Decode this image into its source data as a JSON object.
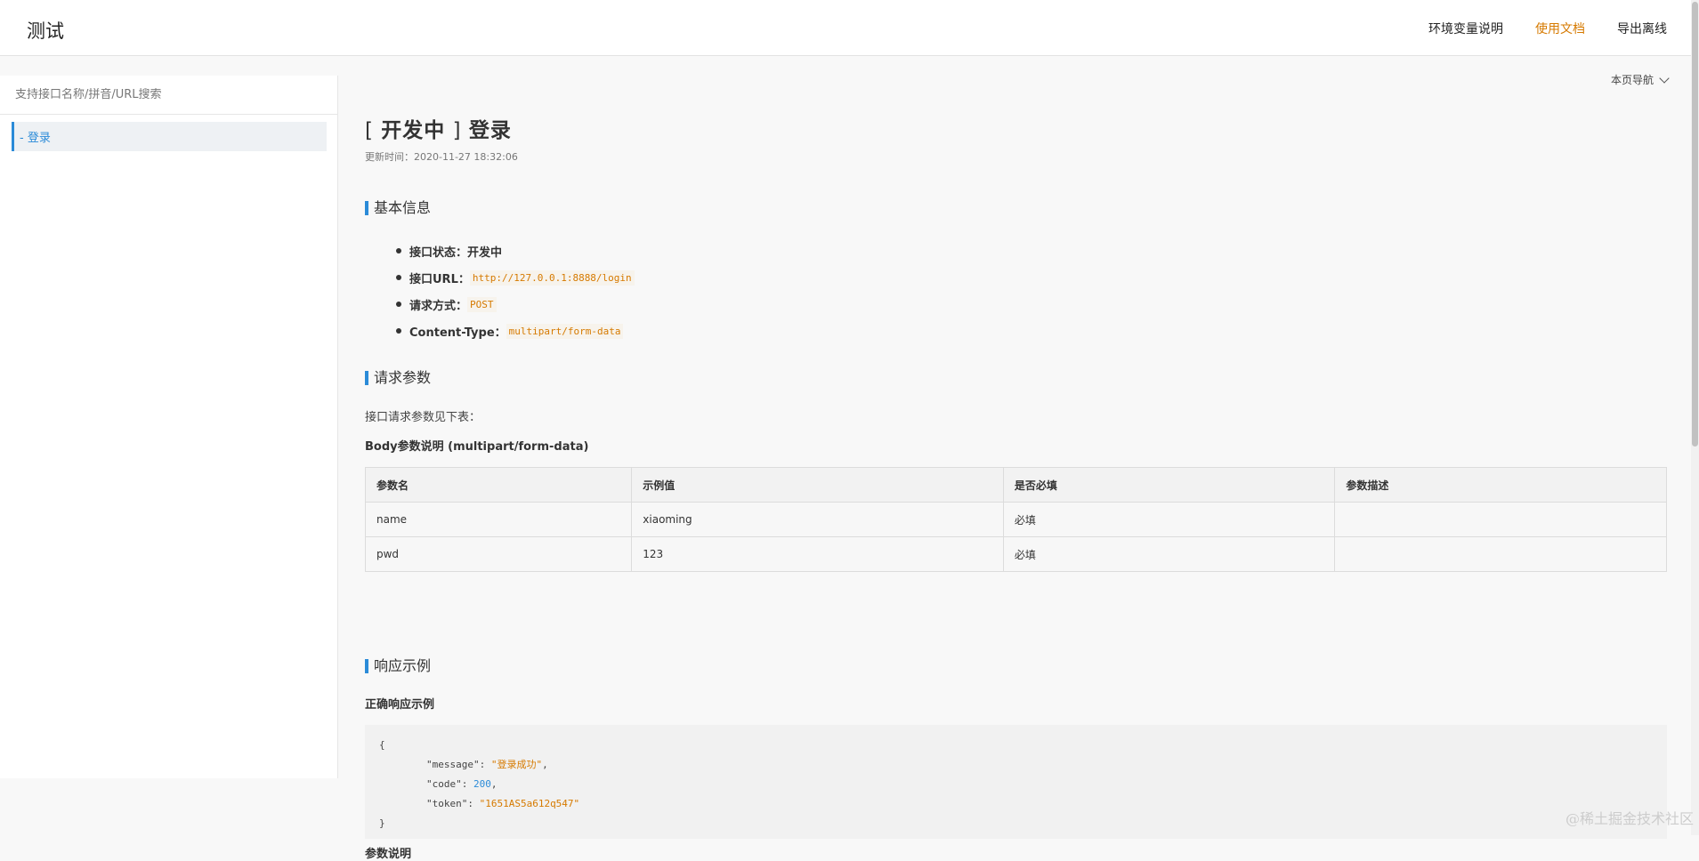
{
  "app": {
    "title": "测试"
  },
  "topnav": [
    {
      "label": "环境变量说明",
      "active": false
    },
    {
      "label": "使用文档",
      "active": true
    },
    {
      "label": "导出离线",
      "active": false
    }
  ],
  "sidebar": {
    "search_placeholder": "支持接口名称/拼音/URL搜索",
    "items": [
      {
        "label": "- 登录"
      }
    ]
  },
  "page": {
    "nav_label": "本页导航",
    "title_status": "开发中",
    "title_name": "登录",
    "updated": "更新时间：2020-11-27 18:32:06"
  },
  "basic_info": {
    "heading": "基本信息",
    "status_key": "接口状态：",
    "status_value": "开发中",
    "url_key": "接口URL：",
    "url_value": "http://127.0.0.1:8888/login",
    "method_key": "请求方式：",
    "method_value": "POST",
    "ctype_key": "Content-Type：",
    "ctype_value": "multipart/form-data"
  },
  "request": {
    "heading": "请求参数",
    "intro": "接口请求参数见下表：",
    "body_title": "Body参数说明 (multipart/form-data)",
    "columns": [
      "参数名",
      "示例值",
      "是否必填",
      "参数描述"
    ],
    "rows": [
      [
        "name",
        "xiaoming",
        "必填",
        ""
      ],
      [
        "pwd",
        "123",
        "必填",
        ""
      ]
    ]
  },
  "response": {
    "heading": "响应示例",
    "ok_title": "正确响应示例",
    "brace_open": "{",
    "brace_close": "}",
    "lines": [
      {
        "key": "\"message\"",
        "value": "\"登录成功\"",
        "kind": "s",
        "sep": ","
      },
      {
        "key": "\"code\"",
        "value": "200",
        "kind": "n",
        "sep": ","
      },
      {
        "key": "\"token\"",
        "value": "\"1651AS5a612q547\"",
        "kind": "s",
        "sep": ""
      }
    ],
    "param_title": "参数说明"
  },
  "watermark": "@稀土掘金技术社区"
}
